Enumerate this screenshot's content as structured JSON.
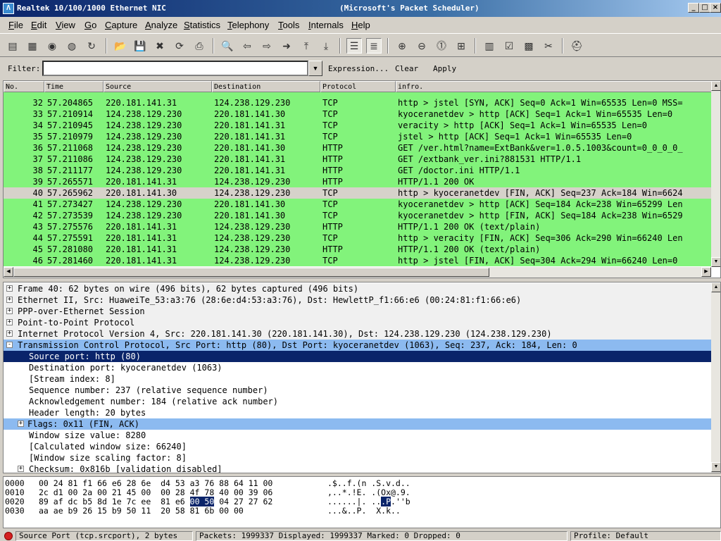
{
  "window": {
    "title_left": "Realtek 10/100/1000 Ethernet NIC",
    "title_right": "(Microsoft's Packet Scheduler)"
  },
  "menu": [
    "File",
    "Edit",
    "View",
    "Go",
    "Capture",
    "Analyze",
    "Statistics",
    "Telephony",
    "Tools",
    "Internals",
    "Help"
  ],
  "filter": {
    "label": "Filter:",
    "value": "",
    "expression": "Expression...",
    "clear": "Clear",
    "apply": "Apply"
  },
  "packet_list": {
    "columns": [
      "No.",
      "Time",
      "Source",
      "Destination",
      "Protocol",
      "infro."
    ],
    "rows": [
      {
        "no": "32",
        "time": "57.204865",
        "src": "220.181.141.31",
        "dst": "124.238.129.230",
        "proto": "TCP",
        "info": "http > jstel [SYN, ACK] Seq=0 Ack=1 Win=65535 Len=0 MSS="
      },
      {
        "no": "33",
        "time": "57.210914",
        "src": "124.238.129.230",
        "dst": "220.181.141.30",
        "proto": "TCP",
        "info": "kyoceranetdev > http [ACK] Seq=1 Ack=1 Win=65535 Len=0"
      },
      {
        "no": "34",
        "time": "57.210945",
        "src": "124.238.129.230",
        "dst": "220.181.141.31",
        "proto": "TCP",
        "info": "veracity > http [ACK] Seq=1 Ack=1 Win=65535 Len=0"
      },
      {
        "no": "35",
        "time": "57.210979",
        "src": "124.238.129.230",
        "dst": "220.181.141.31",
        "proto": "TCP",
        "info": "jstel > http [ACK] Seq=1 Ack=1 Win=65535 Len=0"
      },
      {
        "no": "36",
        "time": "57.211068",
        "src": "124.238.129.230",
        "dst": "220.181.141.30",
        "proto": "HTTP",
        "info": "GET /ver.html?name=ExtBank&ver=1.0.5.1003&count=0_0_0_0_"
      },
      {
        "no": "37",
        "time": "57.211086",
        "src": "124.238.129.230",
        "dst": "220.181.141.31",
        "proto": "HTTP",
        "info": "GET /extbank_ver.ini?881531 HTTP/1.1"
      },
      {
        "no": "38",
        "time": "57.211177",
        "src": "124.238.129.230",
        "dst": "220.181.141.31",
        "proto": "HTTP",
        "info": "GET /doctor.ini HTTP/1.1"
      },
      {
        "no": "39",
        "time": "57.265571",
        "src": "220.181.141.31",
        "dst": "124.238.129.230",
        "proto": "HTTP",
        "info": "HTTP/1.1 200 OK"
      },
      {
        "no": "40",
        "time": "57.265962",
        "src": "220.181.141.30",
        "dst": "124.238.129.230",
        "proto": "TCP",
        "info": "http > kyoceranetdev [FIN, ACK] Seq=237 Ack=184 Win=6624"
      },
      {
        "no": "41",
        "time": "57.273427",
        "src": "124.238.129.230",
        "dst": "220.181.141.30",
        "proto": "TCP",
        "info": "kyoceranetdev > http [ACK] Seq=184 Ack=238 Win=65299 Len"
      },
      {
        "no": "42",
        "time": "57.273539",
        "src": "124.238.129.230",
        "dst": "220.181.141.30",
        "proto": "TCP",
        "info": "kyoceranetdev > http [FIN, ACK] Seq=184 Ack=238 Win=6529"
      },
      {
        "no": "43",
        "time": "57.275576",
        "src": "220.181.141.31",
        "dst": "124.238.129.230",
        "proto": "HTTP",
        "info": "HTTP/1.1 200 OK  (text/plain)"
      },
      {
        "no": "44",
        "time": "57.275591",
        "src": "220.181.141.31",
        "dst": "124.238.129.230",
        "proto": "TCP",
        "info": "http > veracity [FIN, ACK] Seq=306 Ack=290 Win=66240 Len"
      },
      {
        "no": "45",
        "time": "57.281080",
        "src": "220.181.141.31",
        "dst": "124.238.129.230",
        "proto": "HTTP",
        "info": "HTTP/1.1 200 OK  (text/plain)"
      },
      {
        "no": "46",
        "time": "57.281460",
        "src": "220.181.141.31",
        "dst": "124.238.129.230",
        "proto": "TCP",
        "info": "http > jstel [FIN, ACK] Seq=304 Ack=294 Win=66240 Len=0"
      }
    ],
    "selected_no": "40",
    "row_color": "#82f37b",
    "selected_color": "#d6d2ca"
  },
  "details": {
    "lines": [
      {
        "text": "Frame 40: 62 bytes on wire (496 bits), 62 bytes captured (496 bits)",
        "indent": 0,
        "expander": "+",
        "style": "hdr"
      },
      {
        "text": "Ethernet II, Src: HuaweiTe_53:a3:76 (28:6e:d4:53:a3:76), Dst: HewlettP_f1:66:e6 (00:24:81:f1:66:e6)",
        "indent": 0,
        "expander": "+",
        "style": "hdr"
      },
      {
        "text": "PPP-over-Ethernet Session",
        "indent": 0,
        "expander": "+",
        "style": "hdr"
      },
      {
        "text": "Point-to-Point Protocol",
        "indent": 0,
        "expander": "+",
        "style": "hdr"
      },
      {
        "text": "Internet Protocol Version 4, Src: 220.181.141.30 (220.181.141.30), Dst: 124.238.129.230 (124.238.129.230)",
        "indent": 0,
        "expander": "+",
        "style": "hdr"
      },
      {
        "text": "Transmission Control Protocol, Src Port: http (80), Dst Port: kyoceranetdev (1063), Seq: 237, Ack: 184, Len: 0",
        "indent": 0,
        "expander": "-",
        "style": "hl"
      },
      {
        "text": "Source port: http (80)",
        "indent": 1,
        "expander": "",
        "style": "sel"
      },
      {
        "text": "Destination port: kyoceranetdev (1063)",
        "indent": 1,
        "expander": "",
        "style": ""
      },
      {
        "text": "[Stream index: 8]",
        "indent": 1,
        "expander": "",
        "style": ""
      },
      {
        "text": "Sequence number: 237    (relative sequence number)",
        "indent": 1,
        "expander": "",
        "style": ""
      },
      {
        "text": "Acknowledgement number: 184    (relative ack number)",
        "indent": 1,
        "expander": "",
        "style": ""
      },
      {
        "text": "Header length: 20 bytes",
        "indent": 1,
        "expander": "",
        "style": ""
      },
      {
        "text": "Flags: 0x11 (FIN, ACK)",
        "indent": 1,
        "expander": "+",
        "style": "hl"
      },
      {
        "text": "Window size value: 8280",
        "indent": 1,
        "expander": "",
        "style": ""
      },
      {
        "text": "[Calculated window size: 66240]",
        "indent": 1,
        "expander": "",
        "style": ""
      },
      {
        "text": "[Window size scaling factor: 8]",
        "indent": 1,
        "expander": "",
        "style": ""
      },
      {
        "text": "Checksum: 0x816b [validation disabled]",
        "indent": 1,
        "expander": "+",
        "style": ""
      }
    ]
  },
  "hex": {
    "rows": [
      {
        "offset": "0000",
        "pre": "00 24 81 f1 66 e6 28 6e  d4 53 a3 76 88 64 11 00",
        "sel": "",
        "post": "",
        "ascii_pre": ".$..f.(n .S.v.d..",
        "ascii_sel": "",
        "ascii_post": ""
      },
      {
        "offset": "0010",
        "pre": "2c d1 00 2a 00 21 45 00  00 28 4f 78 40 00 39 06",
        "sel": "",
        "post": "",
        "ascii_pre": ",..*.!E. .(Ox@.9.",
        "ascii_sel": "",
        "ascii_post": ""
      },
      {
        "offset": "0020",
        "pre": "89 af dc b5 8d 1e 7c ee  81 e6 ",
        "sel": "00 50",
        "post": " 04 27 27 62",
        "ascii_pre": "......|. ..",
        "ascii_sel": ".P",
        "ascii_post": ".''b"
      },
      {
        "offset": "0030",
        "pre": "aa ae b9 26 15 b9 50 11  20 58 81 6b 00 00",
        "sel": "",
        "post": "",
        "ascii_pre": "...&..P.  X.k..",
        "ascii_sel": "",
        "ascii_post": ""
      }
    ],
    "highlight_color": "#0a246a"
  },
  "status": {
    "field": "Source Port (tcp.srcport), 2 bytes",
    "packets": "Packets: 1999337 Displayed: 1999337 Marked: 0 Dropped: 0",
    "profile": "Profile: Default"
  }
}
